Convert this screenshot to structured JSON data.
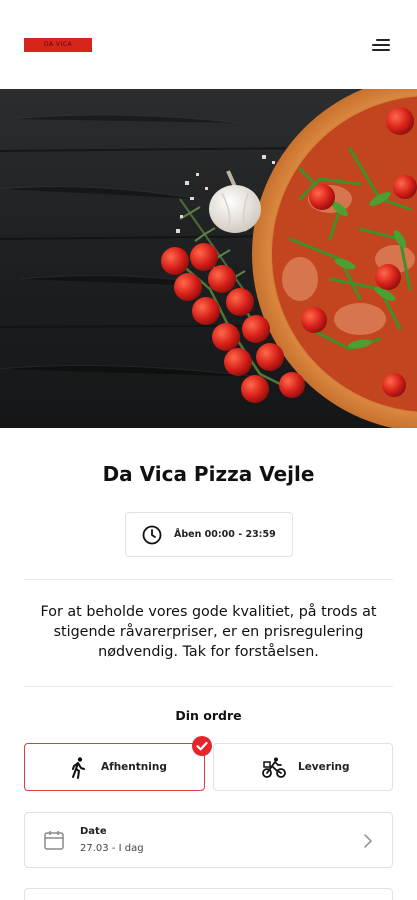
{
  "header": {
    "logo_text": "DA VICA",
    "logo_color": "#d6251b",
    "menu_icon": "hamburger-menu-icon"
  },
  "hero": {
    "image_description": "pizza-with-tomatoes-and-garlic-on-dark-wood"
  },
  "restaurant": {
    "name": "Da Vica Pizza Vejle",
    "hours_icon": "clock-icon",
    "hours": "Åben 00:00 - 23:59"
  },
  "notice": {
    "text": "For at beholde vores gode kvalitiet, på trods at stigende råvarerpriser, er en prisregulering nødvendig. Tak for forståelsen."
  },
  "order": {
    "title": "Din ordre",
    "options": [
      {
        "label": "Afhentning",
        "icon": "walking-person-icon",
        "selected": true
      },
      {
        "label": "Levering",
        "icon": "bicycle-delivery-icon",
        "selected": false
      }
    ],
    "selected_color": "#e3262b",
    "date": {
      "icon": "calendar-icon",
      "label": "Date",
      "value": "27.03 - I dag"
    }
  }
}
